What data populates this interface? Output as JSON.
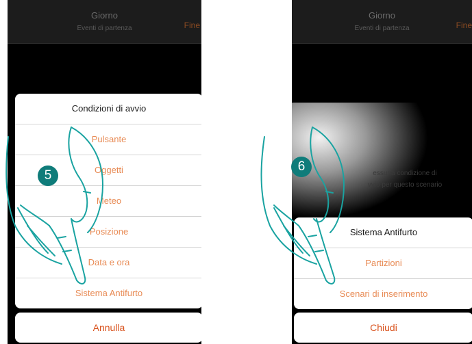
{
  "left_screen": {
    "header": {
      "title": "Giorno",
      "subtitle": "Eventi di partenza",
      "action": "Fine"
    },
    "sheet": {
      "title": "Condizioni di avvio",
      "items": [
        "Pulsante",
        "Oggetti",
        "Meteo",
        "Posizione",
        "Data e ora",
        "Sistema Antifurto"
      ]
    },
    "cancel_label": "Annulla",
    "step_number": "5"
  },
  "right_screen": {
    "header": {
      "title": "Giorno",
      "subtitle": "Eventi di partenza",
      "action": "Fine"
    },
    "empty_message_line1": "essuna condizione di",
    "empty_message_line2": "vvio per questo scenario",
    "sheet": {
      "title": "Sistema Antifurto",
      "items": [
        "Partizioni",
        "Scenari di inserimento"
      ]
    },
    "close_label": "Chiudi",
    "step_number": "6"
  },
  "colors": {
    "accent": "#e88b55",
    "cancel": "#d9531e",
    "step_badge": "#0f7c7a",
    "hand_outline": "#1aa3a1"
  },
  "icons": [
    "pointing-hand-icon"
  ]
}
